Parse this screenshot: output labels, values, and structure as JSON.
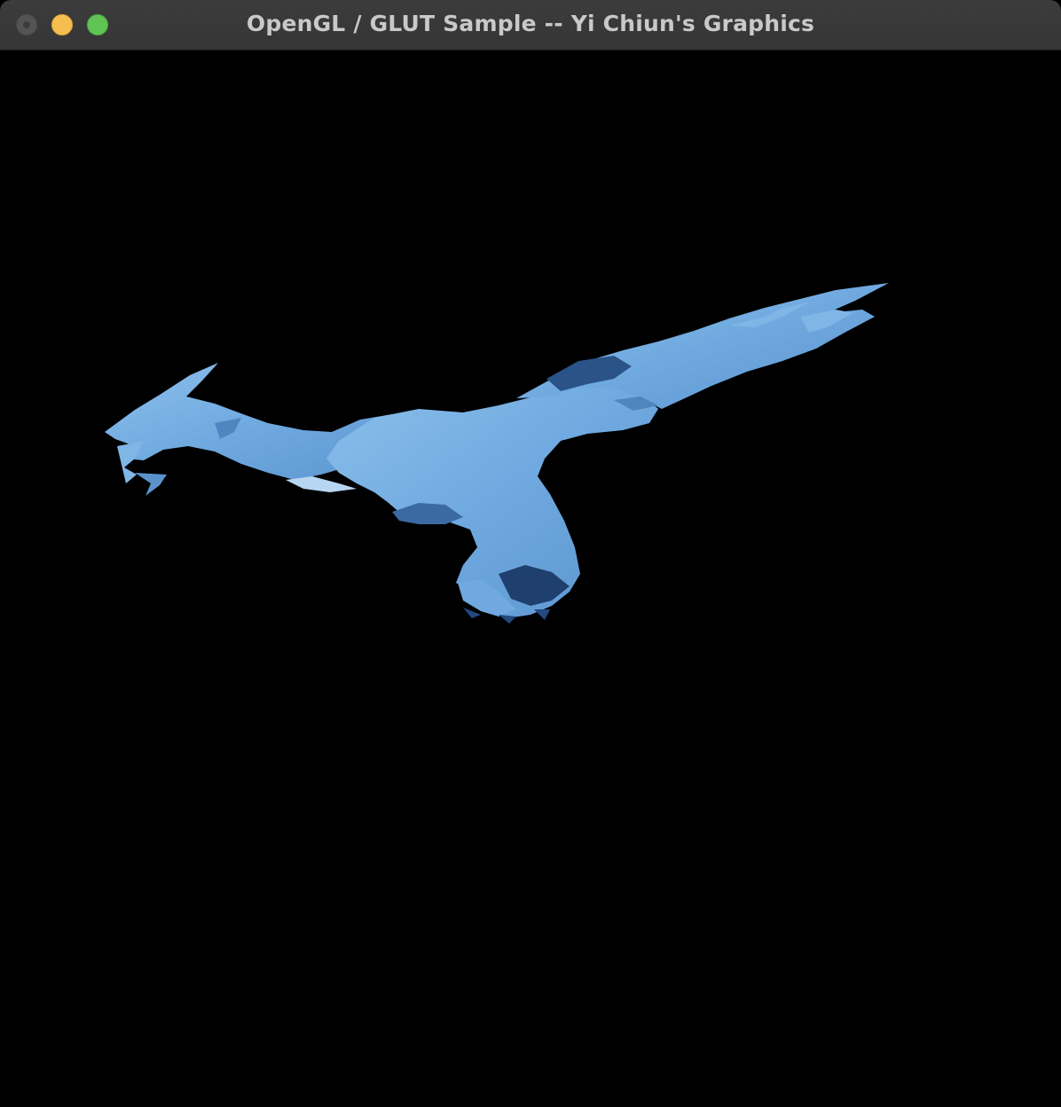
{
  "window": {
    "title": "OpenGL / GLUT Sample -- Yi Chiun's Graphics"
  },
  "colors": {
    "background": "#000000",
    "model_light": "#7fb6e6",
    "model_mid": "#5a93cc",
    "model_dark": "#1f3f6e"
  },
  "viewport": {
    "content": "rendered-3d-dragon-model"
  }
}
